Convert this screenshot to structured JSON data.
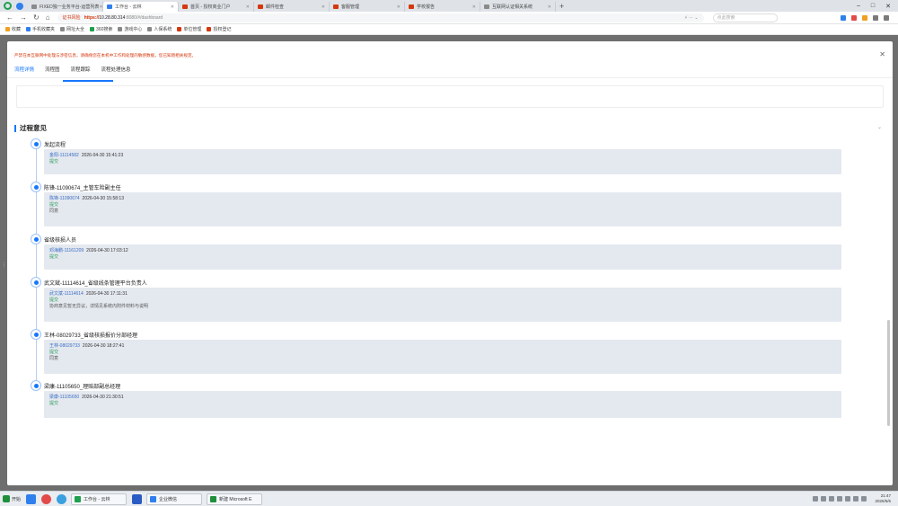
{
  "browser": {
    "tabs": [
      {
        "label": "FIXED独一业务平台-运营列表",
        "color": "#8a8a8a",
        "active": false
      },
      {
        "label": "工作台 - 云林",
        "color": "#2f80ed",
        "active": true
      },
      {
        "label": "首页 - 授权商业门户",
        "color": "#d4380d",
        "active": false
      },
      {
        "label": "邮件检查",
        "color": "#d4380d",
        "active": false
      },
      {
        "label": "客服管理",
        "color": "#d4380d",
        "active": false
      },
      {
        "label": "学校报告",
        "color": "#d4380d",
        "active": false
      },
      {
        "label": "互联网认证相关系统",
        "color": "#8a8a8a",
        "active": false
      }
    ],
    "security_label": "证书风险",
    "url_protocol": "https://",
    "url_host": "10.28.80.314",
    "url_path": ":8080/#/dashboard",
    "search_placeholder": "点此搜索",
    "bookmarks": [
      "收藏",
      "手机收藏夹",
      "网址大全",
      "360搜索",
      "游戏中心",
      "人保系统",
      "单位管理",
      "授权登记"
    ]
  },
  "modal": {
    "notice": "严禁在本互联网中处理与涉密信息，请确保您在本机中工作和处理的敏感数据，您已知晓相关规定。",
    "tabs": [
      "流程详情",
      "流程图",
      "流程跟踪",
      "流程处理信息"
    ],
    "section_title": "过程意见",
    "steps": [
      {
        "title": "发起流程",
        "user": "金阳-11114582",
        "time": "2026-04-30 15:41:23",
        "action": "提交",
        "comment": ""
      },
      {
        "title": "陈锋-11090674_主管车险副主任",
        "user": "陈锋-11090674",
        "time": "2026-04-30 15:58:13",
        "action": "提交",
        "comment": "同意"
      },
      {
        "title": "省级核损人员",
        "user": "邓海鹏-11161209",
        "time": "2026-04-30 17:03:12",
        "action": "提交",
        "comment": ""
      },
      {
        "title": "武文斌-11114614_省级线条管理平台负责人",
        "user": "武文斌-11114614",
        "time": "2026-04-30 17:11:31",
        "action": "提交",
        "comment": "协商意见暂无异议，详情见系统内附件材料与说明"
      },
      {
        "title": "王林-08029733_省级核损报价分部经理",
        "user": "王林-08029733",
        "time": "2026-04-30 18:27:41",
        "action": "提交",
        "comment": "同意"
      },
      {
        "title": "梁康-11105650_理赔部副总经理",
        "user": "梁康-11105650",
        "time": "2026-04-30 21:30:51",
        "action": "提交",
        "comment": ""
      }
    ]
  },
  "taskbar": {
    "start": "开始",
    "tasks": [
      "工作台 - 云林",
      "企业微信",
      "新建 Microsoft E"
    ],
    "clock_time": "21:47",
    "clock_date": "2026/5/6"
  }
}
